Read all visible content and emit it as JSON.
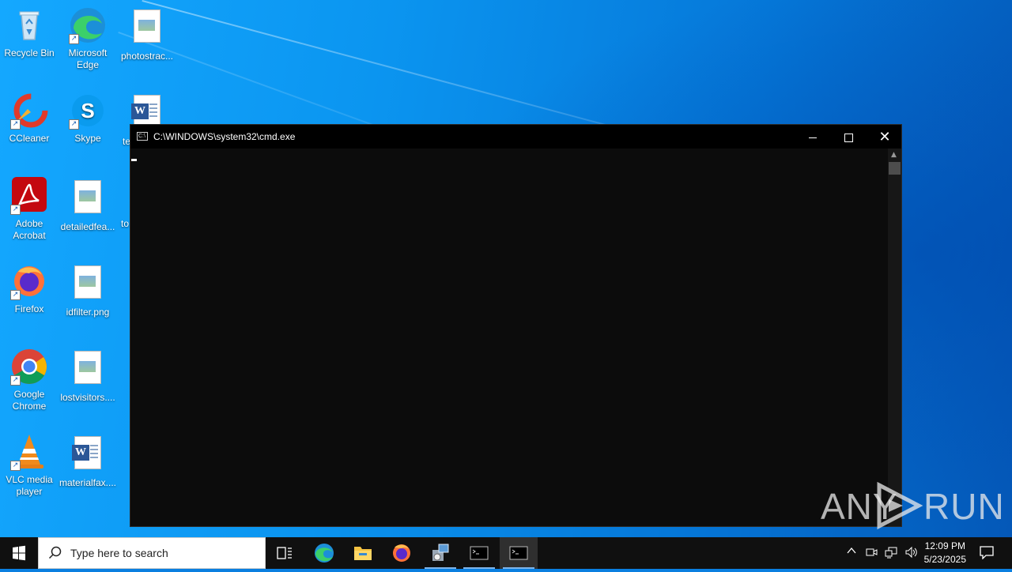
{
  "desktop": {
    "icons": [
      {
        "label": "Recycle Bin",
        "icon": "recycle-bin-icon"
      },
      {
        "label": "Microsoft Edge",
        "icon": "edge-icon"
      },
      {
        "label": "photostrac...",
        "icon": "image-file-icon"
      },
      {
        "label": "CCleaner",
        "icon": "ccleaner-icon"
      },
      {
        "label": "Skype",
        "icon": "skype-icon"
      },
      {
        "label": "te",
        "icon": "word-file-icon"
      },
      {
        "label": "Adobe Acrobat",
        "icon": "acrobat-icon"
      },
      {
        "label": "detailedfea...",
        "icon": "image-file-icon"
      },
      {
        "label": "to",
        "icon": "file-icon"
      },
      {
        "label": "Firefox",
        "icon": "firefox-icon"
      },
      {
        "label": "idfilter.png",
        "icon": "image-file-icon"
      },
      {
        "label": "Google Chrome",
        "icon": "chrome-icon"
      },
      {
        "label": "lostvisitors....",
        "icon": "image-file-icon"
      },
      {
        "label": "VLC media player",
        "icon": "vlc-icon"
      },
      {
        "label": "materialfax....",
        "icon": "word-file-icon"
      }
    ]
  },
  "cmd_window": {
    "title": "C:\\WINDOWS\\system32\\cmd.exe",
    "title_icon_text": "C:\\",
    "minimize_label": "",
    "close_glyph": "✕",
    "scroll_up_glyph": "▲",
    "background": "#0c0c0c"
  },
  "watermark": {
    "left": "ANY",
    "right": "RUN"
  },
  "taskbar": {
    "search_placeholder": "Type here to search",
    "pinned": [
      "task-view-icon",
      "edge-icon",
      "file-explorer-icon",
      "firefox-icon",
      "app-installer-icon",
      "cmd-icon",
      "cmd-icon"
    ],
    "clock": {
      "time": "12:09 PM",
      "date": "5/23/2025"
    },
    "tray_icons": [
      "chevron-up-icon",
      "meet-now-icon",
      "network-icon",
      "volume-icon",
      "notification-icon"
    ],
    "accent": "#7eb4ea"
  }
}
